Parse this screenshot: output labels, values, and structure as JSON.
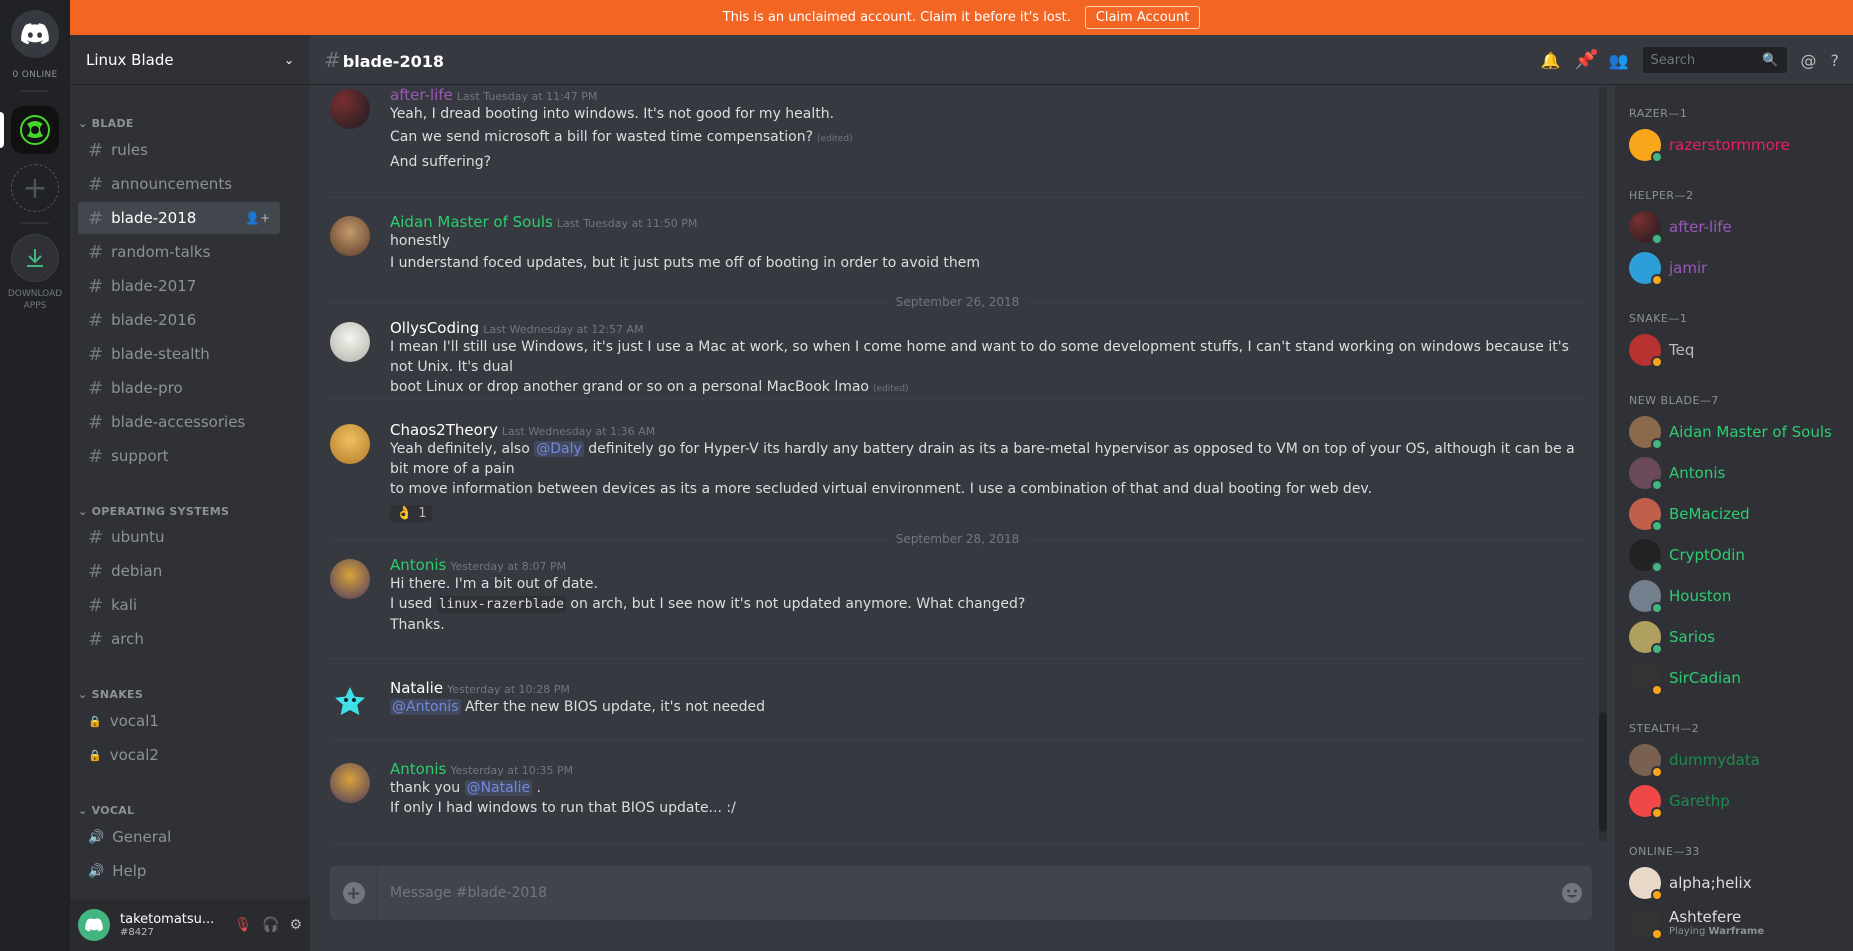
{
  "colors": {
    "accent": "#7289da",
    "banner": "#f26522",
    "online": "#43b581",
    "idle": "#faa61a",
    "helper": "#9b59b6",
    "razer": "#e91e63",
    "newblade": "#2ecc71",
    "stealth": "#1f8b4c",
    "admin": "#e74c3c"
  },
  "guild_bar": {
    "online_label": "0 ONLINE",
    "download_label": "DOWNLOAD APPS"
  },
  "banner": {
    "text": "This is an unclaimed account. Claim it before it's lost.",
    "button": "Claim Account"
  },
  "server": {
    "name": "Linux Blade"
  },
  "categories": [
    {
      "name": "BLADE",
      "channels": [
        "rules",
        "announcements",
        "blade-2018",
        "random-talks",
        "blade-2017",
        "blade-2016",
        "blade-stealth",
        "blade-pro",
        "blade-accessories",
        "support"
      ]
    },
    {
      "name": "OPERATING SYSTEMS",
      "channels": [
        "ubuntu",
        "debian",
        "kali",
        "arch"
      ]
    },
    {
      "name": "SNAKES",
      "channels": [
        "vocal1",
        "vocal2"
      ]
    },
    {
      "name": "VOCAL",
      "channels": [
        "General",
        "Help"
      ]
    }
  ],
  "active_channel": "blade-2018",
  "user": {
    "name": "taketomatsu...",
    "tag": "#8427"
  },
  "chat": {
    "title": "blade-2018",
    "search_placeholder": "Search",
    "composer_placeholder": "Message #blade-2018",
    "messages": [
      {
        "author": "after-life",
        "color": "#9b59b6",
        "ts": "Last Tuesday at 11:47 PM",
        "lines": [
          "Yeah, I dread booting into windows. It's not good for my health.",
          "Can we send microsoft a bill for wasted time compensation?",
          "And suffering?"
        ],
        "edited_line": 1
      },
      {
        "author": "Aidan Master of Souls",
        "color": "#2ecc71",
        "ts": "Last Tuesday at 11:50 PM",
        "lines": [
          "honestly",
          "I understand foced updates, but it just puts me off of booting in order to avoid them"
        ]
      },
      {
        "author": "OllysCoding",
        "color": "#ffffff",
        "ts": "Last Wednesday at 12:57 AM",
        "lines": [
          "I mean I'll still use Windows, it's just I use a Mac at work, so when I come home and want to do some development stuffs, I can't stand working on windows because it's not Unix. It's dual",
          "boot Linux or drop another grand or so on a personal MacBook lmao"
        ],
        "edited_line": 1
      },
      {
        "author": "Chaos2Theory",
        "color": "#ffffff",
        "ts": "Last Wednesday at 1:36 AM",
        "line1_pre": "Yeah definitely, also",
        "mention": "@Daly",
        "line1_post": "definitely go for Hyper-V its hardly any battery drain as its a bare-metal hypervisor as opposed to VM on top of your OS,  although it can be a bit more of a pain",
        "line2": "to move information between devices as its a more secluded virtual environment.   I use a combination of that and dual booting for web dev.",
        "reaction_emoji": "👌",
        "reaction_count": "1"
      },
      {
        "author": "Antonis",
        "color": "#2ecc71",
        "ts": "Yesterday at 8:07 PM",
        "line1": "Hi there. I'm a bit out of date.",
        "line2_pre": "I used",
        "code": "linux-razerblade",
        "line2_post": "on arch, but I see now it's not updated anymore. What changed?",
        "line3": "Thanks."
      },
      {
        "author": "Natalie",
        "color": "#ffffff",
        "ts": "Yesterday at 10:28 PM",
        "mention": "@Antonis",
        "text": "After the new BIOS update, it's not needed"
      },
      {
        "author": "Antonis",
        "color": "#2ecc71",
        "ts": "Yesterday at 10:35 PM",
        "pre": "thank you",
        "mention": "@Natalie",
        "post": ".",
        "line2": "If only I had windows to run that BIOS update... :/"
      }
    ],
    "edited_label": "(edited)",
    "dates": [
      "September 26, 2018",
      "September 28, 2018"
    ]
  },
  "members": {
    "roles": [
      {
        "name": "RAZER—1",
        "members": [
          {
            "name": "razerstormmore",
            "color": "#e91e63",
            "status": "online"
          }
        ]
      },
      {
        "name": "HELPER—2",
        "members": [
          {
            "name": "after-life",
            "color": "#9b59b6",
            "status": "online"
          },
          {
            "name": "jamir",
            "color": "#9b59b6",
            "status": "idle"
          }
        ]
      },
      {
        "name": "SNAKE—1",
        "members": [
          {
            "name": "Teq",
            "color": "#b9bbbe",
            "status": "idle"
          }
        ]
      },
      {
        "name": "NEW BLADE—7",
        "members": [
          {
            "name": "Aidan Master of Souls",
            "color": "#2ecc71",
            "status": "online"
          },
          {
            "name": "Antonis",
            "color": "#2ecc71",
            "status": "online"
          },
          {
            "name": "BeMacized",
            "color": "#2ecc71",
            "status": "online"
          },
          {
            "name": "CryptOdin",
            "color": "#2ecc71",
            "status": "online"
          },
          {
            "name": "Houston",
            "color": "#2ecc71",
            "status": "online"
          },
          {
            "name": "Sarios",
            "color": "#2ecc71",
            "status": "online"
          },
          {
            "name": "SirCadian",
            "color": "#2ecc71",
            "status": "idle"
          }
        ]
      },
      {
        "name": "STEALTH—2",
        "members": [
          {
            "name": "dummydata",
            "color": "#1f8b4c",
            "status": "idle"
          },
          {
            "name": "Garethp",
            "color": "#1f8b4c",
            "status": "idle"
          }
        ]
      },
      {
        "name": "ONLINE—33",
        "members": [
          {
            "name": "alpha;helix",
            "color": "#dcddde",
            "status": "idle"
          },
          {
            "name": "Ashtefere",
            "color": "#dcddde",
            "status": "idle",
            "activity_prefix": "Playing",
            "activity_game": "Warframe"
          }
        ]
      }
    ]
  }
}
